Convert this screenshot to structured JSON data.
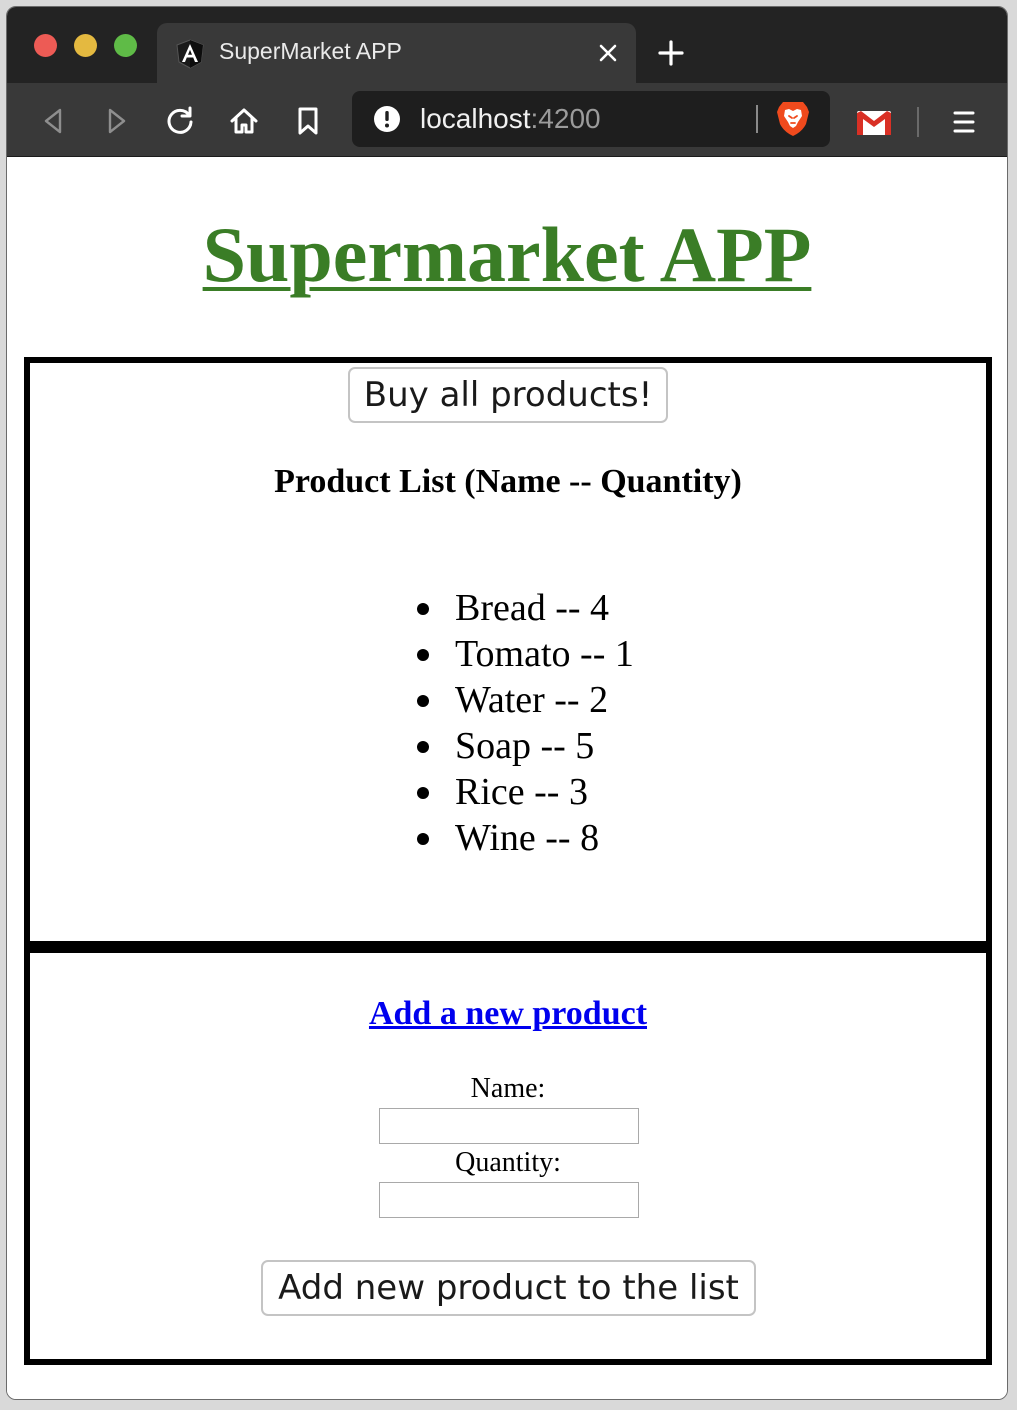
{
  "browser": {
    "tab_title": "SuperMarket APP",
    "url_host": "localhost",
    "url_port": ":4200"
  },
  "page": {
    "title": "Supermarket APP",
    "buy_button": "Buy all products!",
    "list_heading": "Product List (Name -- Quantity)",
    "products": [
      {
        "label": "Bread -- 4"
      },
      {
        "label": "Tomato -- 1"
      },
      {
        "label": "Water -- 2"
      },
      {
        "label": "Soap -- 5"
      },
      {
        "label": "Rice -- 3"
      },
      {
        "label": "Wine -- 8"
      }
    ],
    "add_heading": "Add a new product",
    "name_label": "Name:",
    "name_value": "",
    "quantity_label": "Quantity:",
    "quantity_value": "",
    "add_button": "Add new product to the list"
  },
  "colors": {
    "title_green": "#3a7d26",
    "link_blue": "#0000ee",
    "chrome_dark": "#232323",
    "toolbar": "#393939"
  },
  "icons": [
    "angular-icon",
    "close-icon",
    "plus-icon",
    "back-icon",
    "forward-icon",
    "reload-icon",
    "home-icon",
    "bookmark-icon",
    "info-icon",
    "brave-lion-icon",
    "gmail-icon",
    "menu-icon"
  ]
}
